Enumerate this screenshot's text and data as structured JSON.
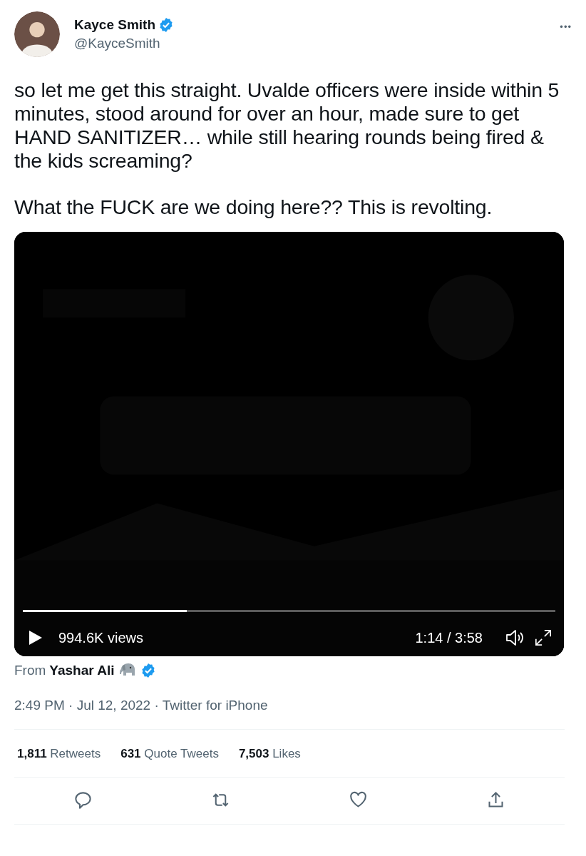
{
  "author": {
    "name": "Kayce Smith",
    "verified": true,
    "handle": "@KayceSmith"
  },
  "menu": {
    "label": "•••"
  },
  "tweet_text": [
    "so let me get this straight. Uvalde officers were inside within 5 minutes, stood around for over an hour, made sure to get HAND SANITIZER… while still hearing rounds being fired & the kids screaming?",
    "What the FUCK are we doing here?? This is revolting."
  ],
  "video": {
    "kind": "picture",
    "progress": {
      "level": 0.308
    },
    "views": "994.6K views",
    "time": "1:14 / 3:58"
  },
  "source": {
    "prefix": "From",
    "name": "Yashar Ali",
    "verified": true
  },
  "meta": "2:49 PM · Jul 12, 2022 · Twitter for iPhone",
  "stats": [
    "**1,811** Retweets",
    "**631** Quote Tweets",
    "**7,503** Likes"
  ],
  "actions": [
    {
      "kind": "reply"
    },
    {
      "kind": "retweet"
    },
    {
      "kind": "like"
    },
    {
      "kind": "share"
    }
  ]
}
